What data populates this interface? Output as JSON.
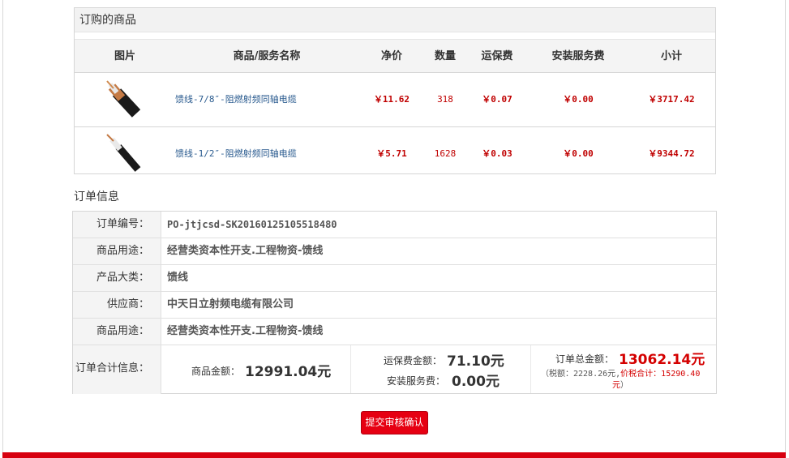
{
  "goods": {
    "title": "订购的商品",
    "headers": [
      "图片",
      "商品/服务名称",
      "净价",
      "数量",
      "运保费",
      "安装服务费",
      "小计"
    ],
    "items": [
      {
        "name": "馈线-7/8″-阻燃射频同轴电缆",
        "price": "￥11.62",
        "qty": "318",
        "shipping": "￥0.07",
        "install": "￥0.00",
        "subtotal": "￥3717.42",
        "image": "coax-cable-7-8-image"
      },
      {
        "name": "馈线-1/2″-阻燃射频同轴电缆",
        "price": "￥5.71",
        "qty": "1628",
        "shipping": "￥0.03",
        "install": "￥0.00",
        "subtotal": "￥9344.72",
        "image": "coax-cable-1-2-image"
      }
    ]
  },
  "order": {
    "title": "订单信息",
    "rows": [
      {
        "label": "订单编号：",
        "value": "PO-jtjcsd-SK20160125105518480"
      },
      {
        "label": "商品用途：",
        "value": "经营类资本性开支.工程物资-馈线"
      },
      {
        "label": "产品大类：",
        "value": "馈线"
      },
      {
        "label": "供应商：",
        "value": "中天日立射频电缆有限公司"
      },
      {
        "label": "商品用途：",
        "value": "经营类资本性开支.工程物资-馈线"
      }
    ],
    "total": {
      "label": "订单合计信息：",
      "goods_label": "商品金额：",
      "goods_amount": "12991.04元",
      "shipping_label": "运保费金额：",
      "shipping_amount": "71.10元",
      "install_label": "安装服务费：",
      "install_amount": "0.00元",
      "order_total_label": "订单总金额：",
      "order_total": "13062.14元",
      "tax_prefix": "（税额：2228.26元,",
      "tax_total": "价税合计：15290.40",
      "tax_total_cont": "元",
      "tax_close": "）"
    }
  },
  "actions": {
    "submit_label": "提交审核确认"
  },
  "colors": {
    "accent": "#e60012",
    "price": "#c00000",
    "link": "#2a5b8f"
  }
}
